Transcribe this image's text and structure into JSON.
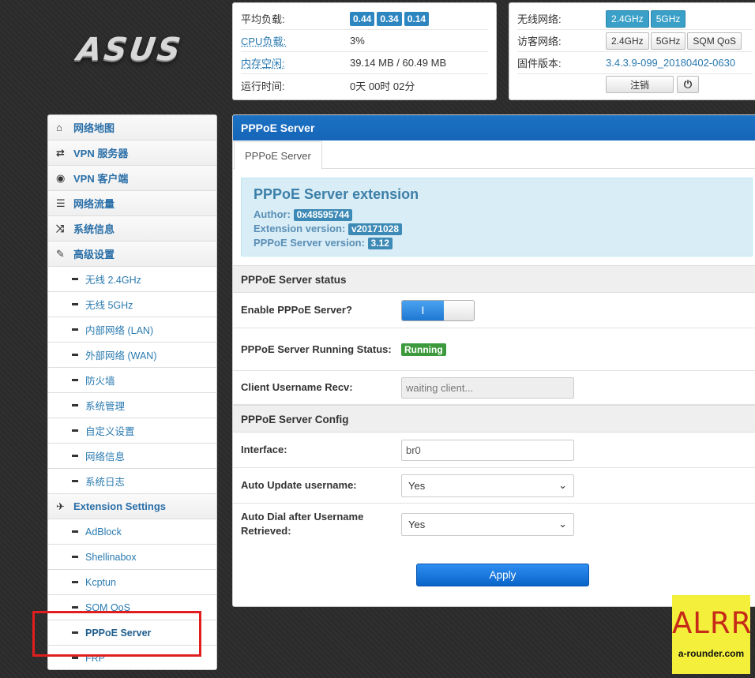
{
  "brand": {
    "logo": "ASUS"
  },
  "stats": {
    "rows": [
      {
        "label": "平均负载:",
        "badges": [
          "0.44",
          "0.34",
          "0.14"
        ]
      },
      {
        "label": "CPU负载:",
        "value": "3%"
      },
      {
        "label": "内存空闲:",
        "value": "39.14 MB / 60.49 MB"
      },
      {
        "label": "运行时间:",
        "value": "0天 00时 02分"
      }
    ]
  },
  "info": {
    "wireless_label": "无线网络:",
    "wireless": [
      "2.4GHz",
      "5GHz"
    ],
    "guest_label": "访客网络:",
    "guest": [
      "2.4GHz",
      "5GHz",
      "SQM QoS"
    ],
    "firmware_label": "固件版本:",
    "firmware": "3.4.3.9-099_20180402-0630",
    "logout": "注销",
    "power_icon": "⏻"
  },
  "sidebar": {
    "items": [
      {
        "label": "网络地图",
        "icon": "home-icon",
        "glyph": "⌂"
      },
      {
        "label": "VPN 服务器",
        "icon": "arrows-icon",
        "glyph": "⇄"
      },
      {
        "label": "VPN 客户端",
        "icon": "globe-icon",
        "glyph": "◉"
      },
      {
        "label": "网络流量",
        "icon": "list-icon",
        "glyph": "☰"
      },
      {
        "label": "系统信息",
        "icon": "shuffle-icon",
        "glyph": "⤨"
      },
      {
        "label": "高级设置",
        "icon": "wrench-icon",
        "glyph": "✎"
      }
    ],
    "advanced": [
      "无线 2.4GHz",
      "无线 5GHz",
      "内部网络 (LAN)",
      "外部网络 (WAN)",
      "防火墙",
      "系统管理",
      "自定义设置",
      "网络信息",
      "系统日志"
    ],
    "ext_header": {
      "label": "Extension Settings",
      "icon": "plane-icon",
      "glyph": "✈"
    },
    "extensions": [
      "AdBlock",
      "Shellinabox",
      "Kcptun",
      "SQM QoS",
      "PPPoE Server",
      "FRP"
    ],
    "active": "PPPoE Server"
  },
  "main": {
    "title": "PPPoE Server",
    "tab": "PPPoE Server",
    "ext": {
      "title": "PPPoE Server extension",
      "author_label": "Author:",
      "author": "0x48595744",
      "version_label": "Extension version:",
      "version": "v20171028",
      "server_version_label": "PPPoE Server version:",
      "server_version": "3.12"
    },
    "status_section": "PPPoE Server status",
    "enable_label": "Enable PPPoE Server?",
    "enable_value": "I",
    "running_label": "PPPoE Server Running Status:",
    "running_value": "Running",
    "client_label": "Client Username Recv:",
    "client_value": "waiting client...",
    "config_section": "PPPoE Server Config",
    "interface_label": "Interface:",
    "interface_value": "br0",
    "auto_update_label": "Auto Update username:",
    "auto_update_value": "Yes",
    "auto_dial_label": "Auto Dial after Username Retrieved:",
    "auto_dial_value": "Yes",
    "apply": "Apply"
  },
  "watermark": {
    "big": "ALRR",
    "small": "a-rounder.com"
  },
  "colors": {
    "accent": "#1565b8",
    "running": "#3c9a3c",
    "highlight": "#e01e1e"
  }
}
